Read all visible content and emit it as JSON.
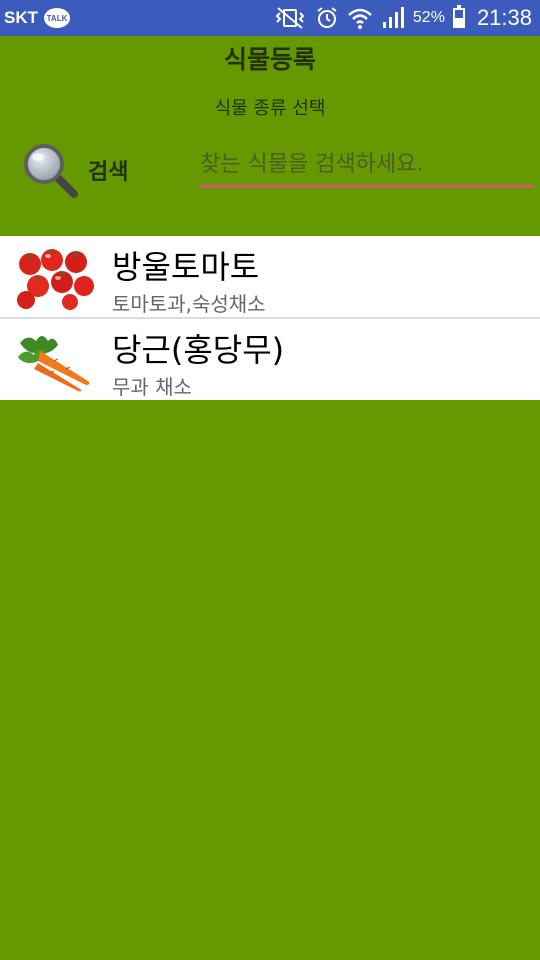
{
  "status_bar": {
    "carrier": "SKT",
    "talk_badge": "TALK",
    "battery": "52%",
    "battery_level": 0.52,
    "time": "21:38"
  },
  "header": {
    "title": "식물등록",
    "subtitle": "식물 종류 선택"
  },
  "search": {
    "label": "검색",
    "placeholder": "찾는 식물을 검색하세요."
  },
  "plants": [
    {
      "name": "방울토마토",
      "desc": "토마토과,숙성채소",
      "icon": "tomato-icon"
    },
    {
      "name": "당근(홍당무)",
      "desc": "무과 채소",
      "icon": "carrot-icon"
    }
  ]
}
